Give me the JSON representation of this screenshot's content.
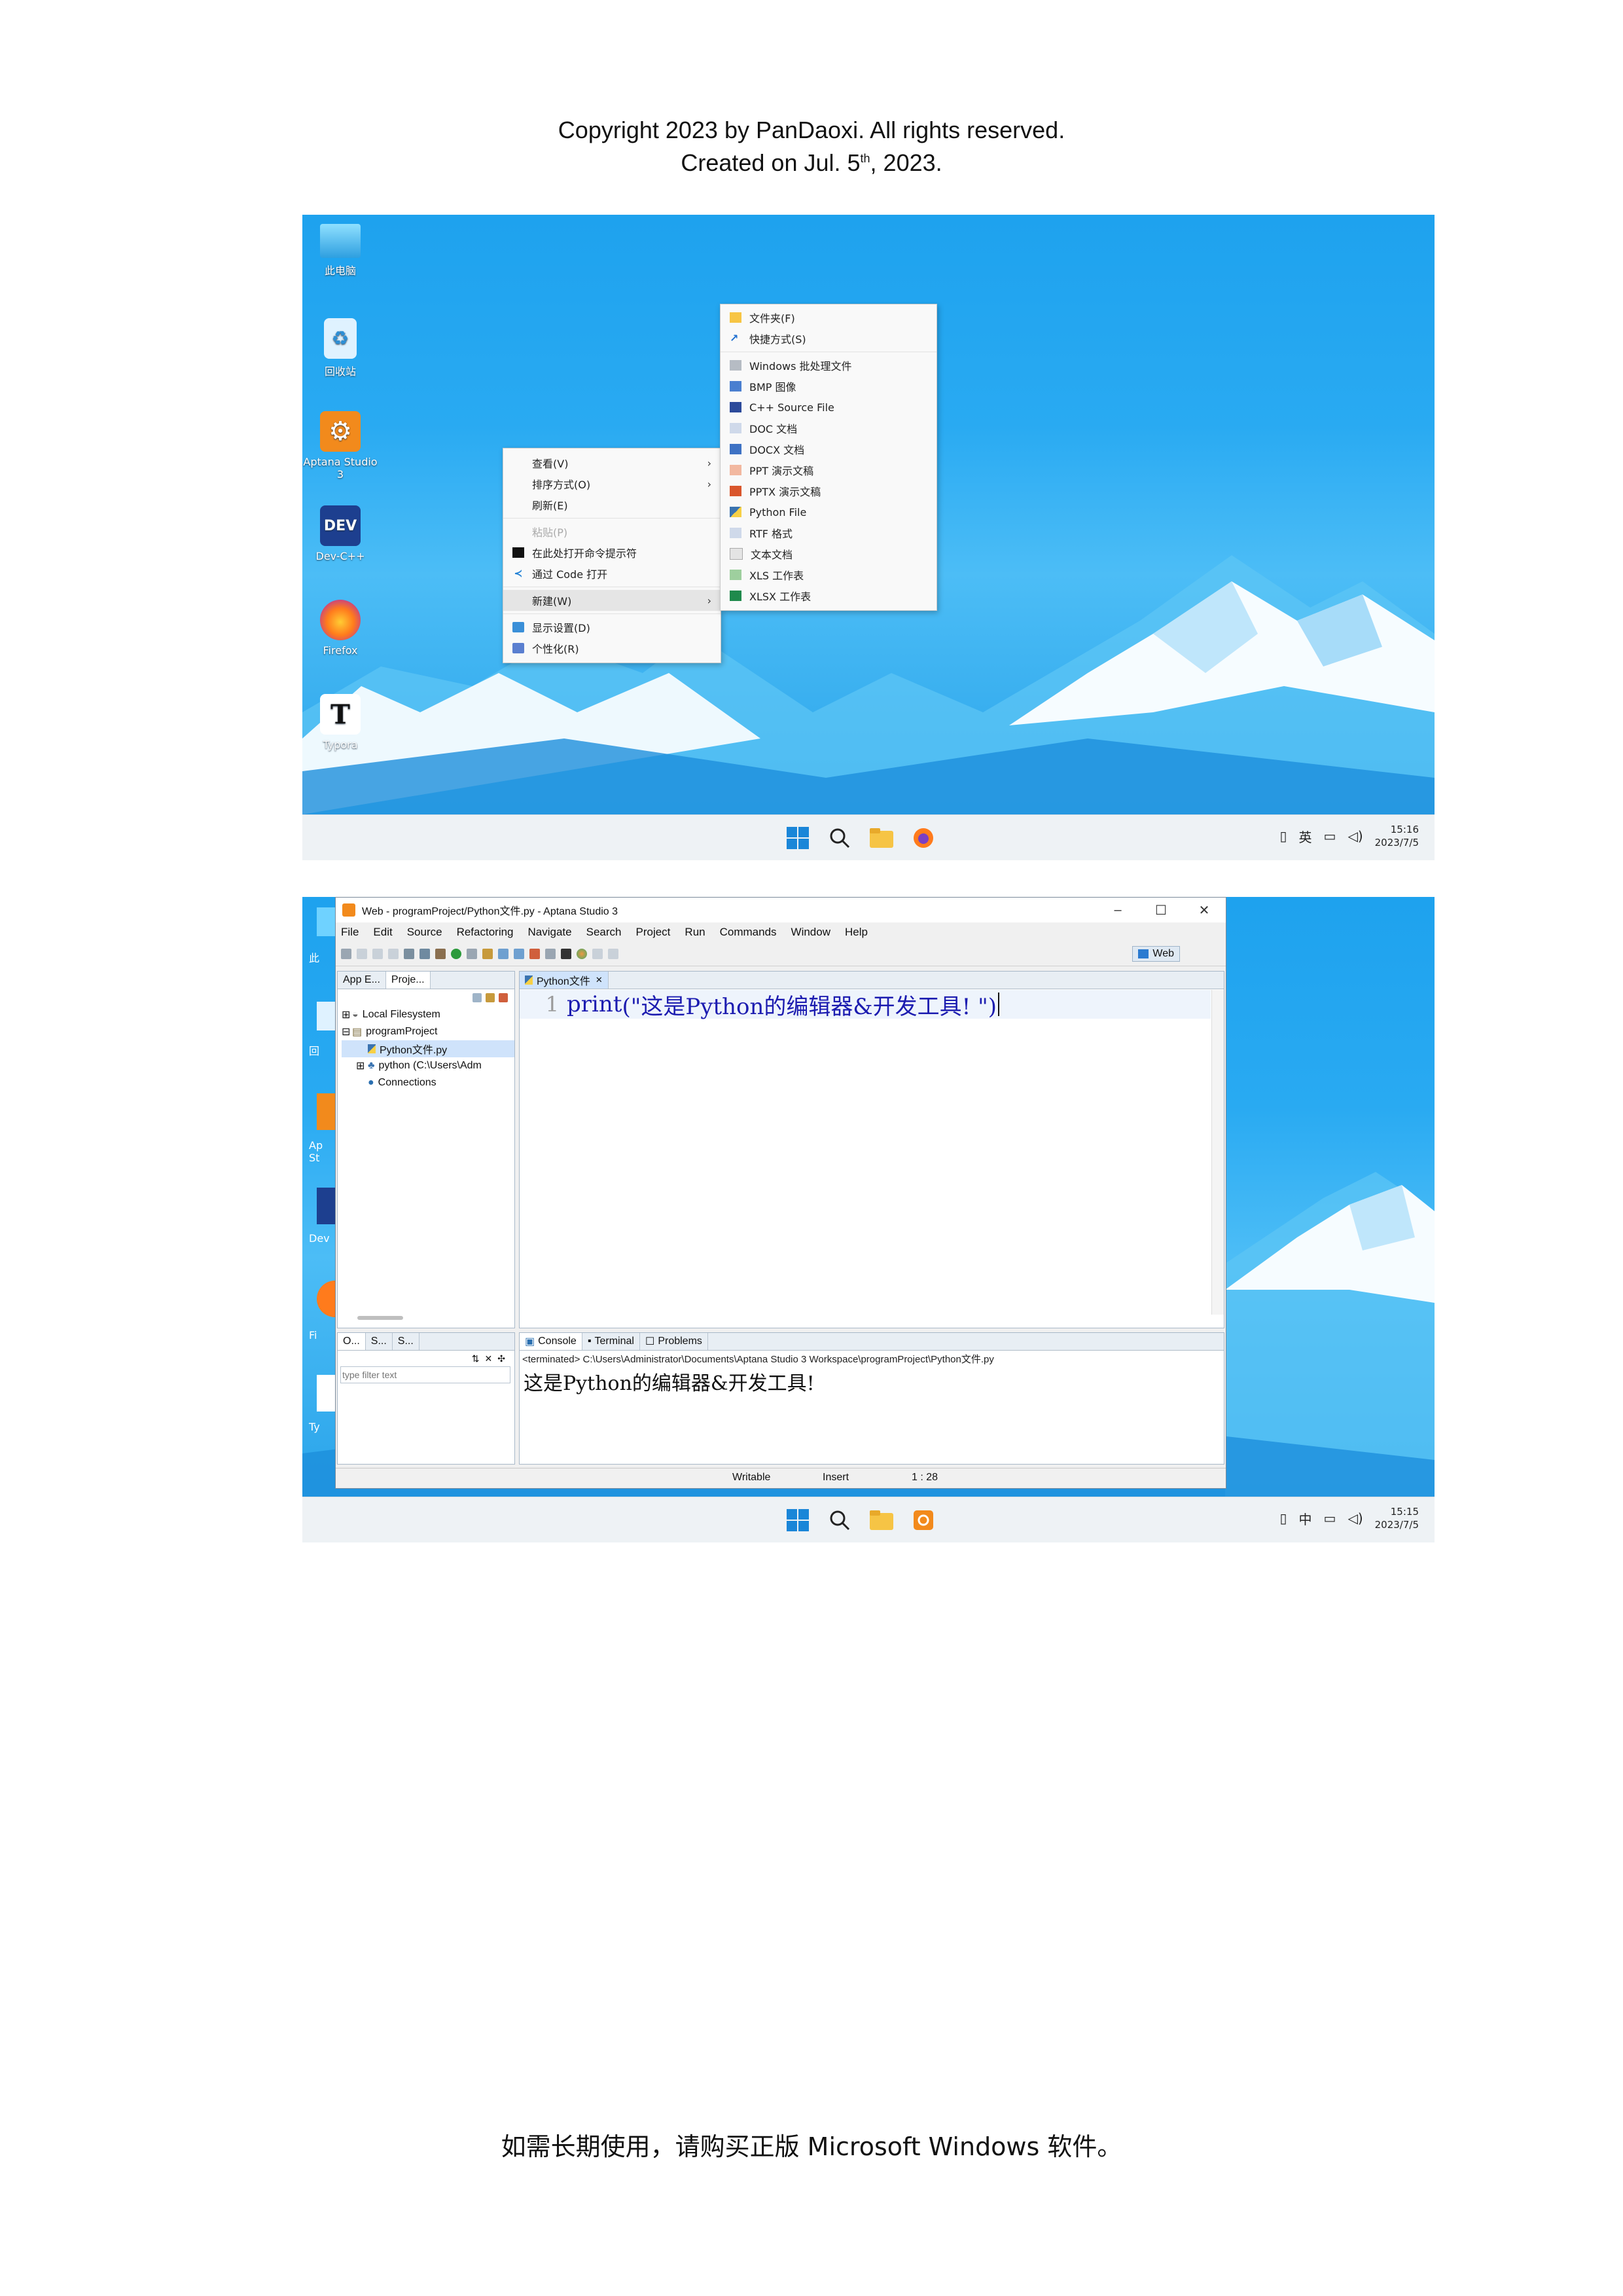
{
  "header": {
    "line1": "Copyright 2023 by PanDaoxi. All rights reserved.",
    "line2_pre": "Created on Jul. 5",
    "line2_sup": "th",
    "line2_post": ", 2023."
  },
  "screen1": {
    "desktop_icons": [
      {
        "label": "此电脑",
        "icon": "monitor-icon"
      },
      {
        "label": "回收站",
        "icon": "recycle-bin-icon"
      },
      {
        "label": "Aptana Studio 3",
        "icon": "aptana-icon"
      },
      {
        "label": "Dev-C++",
        "icon": "devcpp-icon"
      },
      {
        "label": "Firefox",
        "icon": "firefox-icon"
      },
      {
        "label": "Typora",
        "icon": "typora-icon"
      }
    ],
    "context_menu": {
      "view": "查看(V)",
      "sort": "排序方式(O)",
      "refresh": "刷新(E)",
      "paste": "粘贴(P)",
      "open_terminal": "在此处打开命令提示符",
      "open_vscode": "通过 Code 打开",
      "new": "新建(W)",
      "display": "显示设置(D)",
      "personalize": "个性化(R)"
    },
    "new_submenu": [
      "文件夹(F)",
      "快捷方式(S)",
      "Windows 批处理文件",
      "BMP 图像",
      "C++ Source File",
      "DOC 文档",
      "DOCX 文档",
      "PPT 演示文稿",
      "PPTX 演示文稿",
      "Python File",
      "RTF 格式",
      "文本文档",
      "XLS 工作表",
      "XLSX 工作表"
    ],
    "tray": {
      "ime": "英",
      "time": "15:16",
      "date": "2023/7/5"
    }
  },
  "screen2": {
    "desktop_icons_partial": [
      "此",
      "回",
      "Ap St",
      "Dev",
      "Fi",
      "Ty"
    ],
    "window_title": "Web - programProject/Python文件.py - Aptana Studio 3",
    "menu": [
      "File",
      "Edit",
      "Source",
      "Refactoring",
      "Navigate",
      "Search",
      "Project",
      "Run",
      "Commands",
      "Window",
      "Help"
    ],
    "perspective": "Web",
    "left_tabs": [
      "App E...",
      "Proje..."
    ],
    "tree": {
      "local_fs": "Local Filesystem",
      "project": "programProject",
      "file": "Python文件.py",
      "python": "python  (C:\\Users\\Adm",
      "connections": "Connections"
    },
    "outline_tabs": [
      "O...",
      "S...",
      "S..."
    ],
    "filter_placeholder": "type filter text",
    "editor_tab": "Python文件",
    "line_number": "1",
    "code_kw": "print",
    "code_rest": "(\"这是Python的编辑器&开发工具! \")",
    "console_tabs": [
      "Console",
      "Terminal",
      "Problems"
    ],
    "terminated": "<terminated> C:\\Users\\Administrator\\Documents\\Aptana Studio 3 Workspace\\programProject\\Python文件.py",
    "console_output": "这是Python的编辑器&开发工具!",
    "status": {
      "writable": "Writable",
      "insert": "Insert",
      "position": "1 : 28"
    },
    "tray": {
      "ime": "中",
      "time": "15:15",
      "date": "2023/7/5"
    }
  },
  "footer": "如需长期使用，请购买正版 Microsoft Windows 软件。"
}
